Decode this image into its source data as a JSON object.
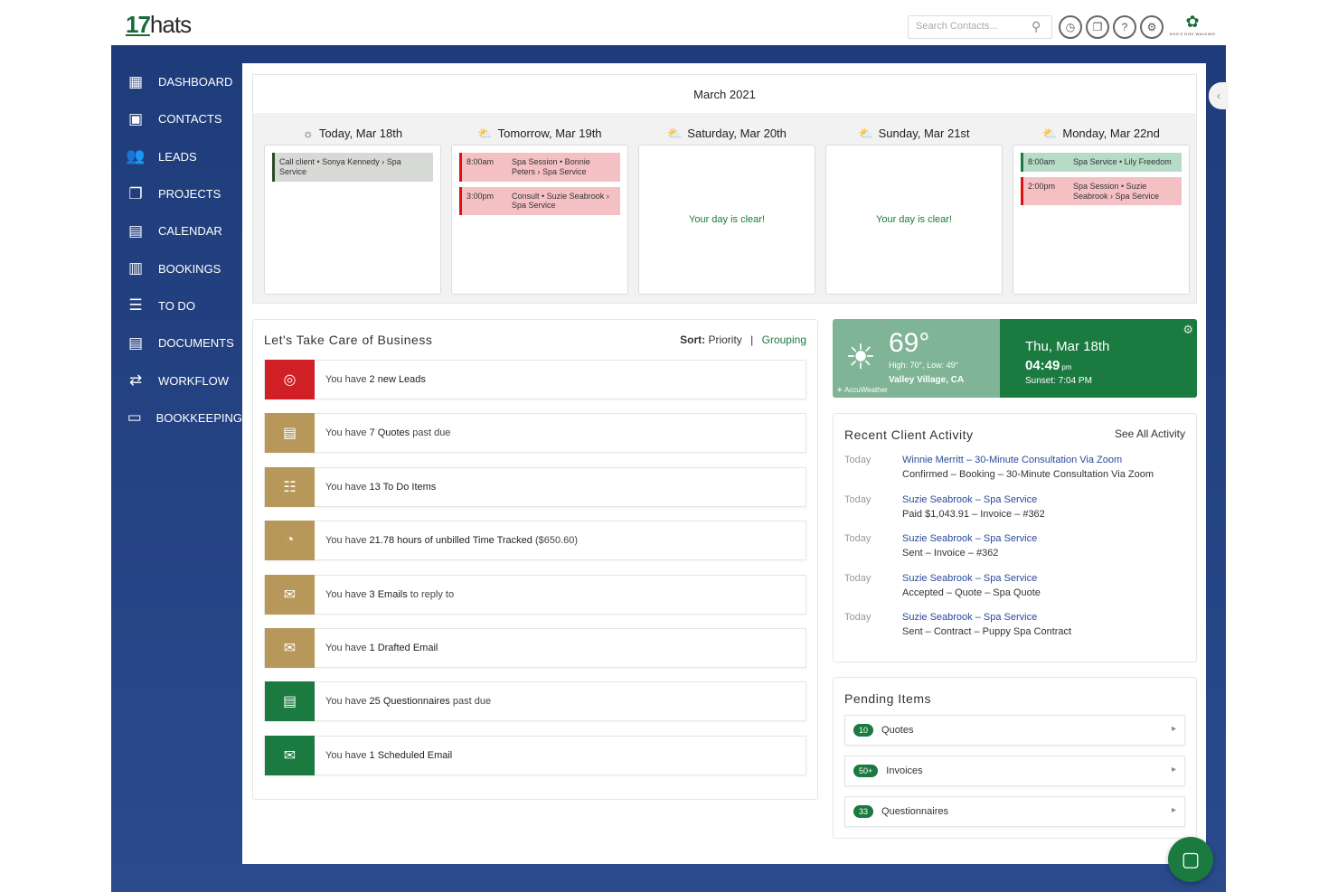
{
  "header": {
    "logo_num": "17",
    "logo_word": "hats",
    "search_placeholder": "Search Contacts...",
    "brand_mark": "DOG'S DOG WALKING"
  },
  "nav": {
    "items": [
      {
        "label": "DASHBOARD",
        "icon": "dashboard-icon"
      },
      {
        "label": "CONTACTS",
        "icon": "contacts-icon"
      },
      {
        "label": "LEADS",
        "icon": "leads-icon"
      },
      {
        "label": "PROJECTS",
        "icon": "projects-icon"
      },
      {
        "label": "CALENDAR",
        "icon": "calendar-icon"
      },
      {
        "label": "BOOKINGS",
        "icon": "bookings-icon"
      },
      {
        "label": "TO DO",
        "icon": "todo-icon"
      },
      {
        "label": "DOCUMENTS",
        "icon": "documents-icon"
      },
      {
        "label": "WORKFLOW",
        "icon": "workflow-icon"
      },
      {
        "label": "BOOKKEEPING",
        "icon": "bookkeeping-icon"
      }
    ]
  },
  "calendar": {
    "month": "March 2021",
    "days": [
      {
        "title": "Today, Mar 18th",
        "weather": "sun-icon",
        "clear": "",
        "events": [
          {
            "time": "",
            "desc": "Call client • Sonya Kennedy › Spa Service",
            "style": "grey"
          }
        ]
      },
      {
        "title": "Tomorrow, Mar 19th",
        "weather": "cloud-sun-icon",
        "clear": "",
        "events": [
          {
            "time": "8:00am",
            "desc": "Spa Session • Bonnie Peters › Spa Service",
            "style": "red"
          },
          {
            "time": "3:00pm",
            "desc": "Consult • Suzie Seabrook › Spa Service",
            "style": "red"
          }
        ]
      },
      {
        "title": "Saturday, Mar 20th",
        "weather": "cloud-sun-icon",
        "clear": "Your day is clear!",
        "events": []
      },
      {
        "title": "Sunday, Mar 21st",
        "weather": "cloud-sun-icon",
        "clear": "Your day is clear!",
        "events": []
      },
      {
        "title": "Monday, Mar 22nd",
        "weather": "cloud-sun-icon",
        "clear": "",
        "events": [
          {
            "time": "8:00am",
            "desc": "Spa Service • Lily Freedom",
            "style": "green"
          },
          {
            "time": "2:00pm",
            "desc": "Spa Session • Suzie Seabrook › Spa Service",
            "style": "red"
          }
        ]
      }
    ]
  },
  "business": {
    "title": "Let's Take Care of Business",
    "sort_label": "Sort:",
    "sort_value": "Priority",
    "sort_sep": "|",
    "grouping": "Grouping",
    "tasks": [
      {
        "pre": "You have ",
        "bold": "2 new Leads",
        "post": "",
        "color": "#d11f26",
        "icon": "lead-icon"
      },
      {
        "pre": "You have ",
        "bold": "7 Quotes",
        "post": " past due",
        "color": "#b8985a",
        "icon": "quote-icon"
      },
      {
        "pre": "You have ",
        "bold": "13 To Do Items",
        "post": "",
        "color": "#b8985a",
        "icon": "list-icon"
      },
      {
        "pre": "You have ",
        "bold": "21.78 hours of unbilled Time Tracked",
        "post": " ($650.60)",
        "color": "#b8985a",
        "icon": "stopwatch-icon"
      },
      {
        "pre": "You have ",
        "bold": "3 Emails",
        "post": " to reply to",
        "color": "#b8985a",
        "icon": "mail-icon"
      },
      {
        "pre": "You have ",
        "bold": "1 Drafted Email",
        "post": "",
        "color": "#b8985a",
        "icon": "draft-mail-icon"
      },
      {
        "pre": "You have ",
        "bold": "25 Questionnaires",
        "post": " past due",
        "color": "#1a7a3f",
        "icon": "questionnaire-icon"
      },
      {
        "pre": "You have ",
        "bold": "1 Scheduled Email",
        "post": "",
        "color": "#1a7a3f",
        "icon": "scheduled-mail-icon"
      }
    ]
  },
  "weather": {
    "temp": "69°",
    "hilo": "High: 70°, Low: 49°",
    "location": "Valley Village, CA",
    "brand": "AccuWeather",
    "date": "Thu, Mar 18th",
    "time": "04:49",
    "ampm": "pm",
    "sunset": "Sunset: 7:04 PM"
  },
  "activity": {
    "title": "Recent Client Activity",
    "see_all": "See All Activity",
    "rows": [
      {
        "when": "Today",
        "l1": "Winnie Merritt  –  30-Minute Consultation Via Zoom",
        "l2": "Confirmed  –  Booking  –  30-Minute Consultation Via Zoom"
      },
      {
        "when": "Today",
        "l1": "Suzie Seabrook  –  Spa Service",
        "l2": "Paid $1,043.91  –  Invoice  –  #362"
      },
      {
        "when": "Today",
        "l1": "Suzie Seabrook  –  Spa Service",
        "l2": "Sent  –  Invoice  –  #362"
      },
      {
        "when": "Today",
        "l1": "Suzie Seabrook  –  Spa Service",
        "l2": "Accepted  –  Quote  –  Spa Quote"
      },
      {
        "when": "Today",
        "l1": "Suzie Seabrook  –  Spa Service",
        "l2": "Sent  –  Contract  –  Puppy Spa Contract"
      }
    ]
  },
  "pending": {
    "title": "Pending Items",
    "items": [
      {
        "badge": "10",
        "label": "Quotes"
      },
      {
        "badge": "50+",
        "label": "Invoices"
      },
      {
        "badge": "33",
        "label": "Questionnaires"
      }
    ]
  }
}
